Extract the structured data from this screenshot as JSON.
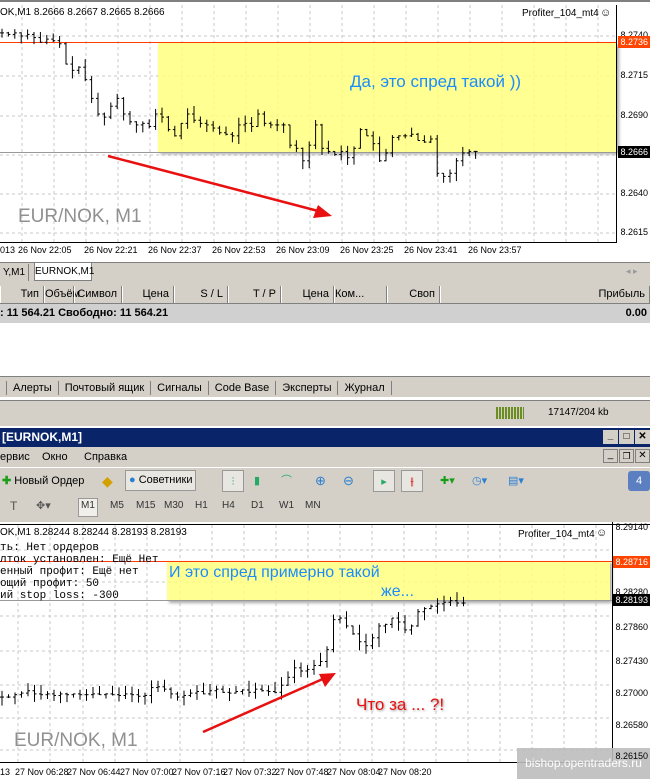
{
  "top_chart": {
    "info": "OK,M1  8.2666 8.2667 8.2665 8.2666",
    "expert": "Profiter_104_mt4",
    "annotation": "Да, это спред такой ))",
    "watermark": "EUR/NOK, M1",
    "ask_price": "8.2736",
    "bid_price": "8.2666",
    "ticks": [
      "8.2740",
      "8.2715",
      "8.2690",
      "8.2640",
      "8.2615"
    ],
    "times": [
      "013",
      "26 Nov 22:05",
      "26 Nov 22:21",
      "26 Nov 22:37",
      "26 Nov 22:53",
      "26 Nov 23:09",
      "26 Nov 23:25",
      "26 Nov 23:41",
      "26 Nov 23:57"
    ]
  },
  "chart_tabs": [
    "Y,M1",
    "EURNOK,M1"
  ],
  "terminal": {
    "columns": [
      "Тип",
      "Объём",
      "Символ",
      "Цена",
      "S / L",
      "T / P",
      "Цена",
      "Ком...",
      "Своп",
      "Прибыль"
    ],
    "balance": ": 11 564.21  Свободно: 11 564.21",
    "profit": "0.00",
    "tabs": [
      "Алерты",
      "Почтовый ящик",
      "Сигналы",
      "Code Base",
      "Эксперты",
      "Журнал"
    ]
  },
  "status": {
    "traffic": "17147/204 kb"
  },
  "window": {
    "title": "[EURNOK,M1]"
  },
  "menu": [
    "ервис",
    "Окно",
    "Справка"
  ],
  "toolbar": {
    "new_order": "Новый Ордер",
    "experts": "Советники",
    "badge": "4"
  },
  "timeframes": [
    "M1",
    "M5",
    "M15",
    "M30",
    "H1",
    "H4",
    "D1",
    "W1",
    "MN"
  ],
  "bottom_chart": {
    "info": "OK,M1  8.28244 8.28244 8.28193 8.28193",
    "expert": "Profiter_104_mt4",
    "comments": [
      "ть: Нет ордеров",
      "лток установлен: Ещё Нет",
      "енный профит: Ещё нет",
      "ощий профит: 50",
      "ий stop loss: -300"
    ],
    "annotation1": "И это спред примерно такой",
    "annotation2": "же...",
    "annotation3": "Что за ... ?!",
    "watermark": "EUR/NOK, M1",
    "ask_price": "8.28716",
    "bid_price": "8.28193",
    "ticks": [
      "8.29140",
      "8.28280",
      "8.27860",
      "8.27430",
      "8.27000",
      "8.26580",
      "8.26150"
    ],
    "times": [
      "13",
      "27 Nov 06:28",
      "27 Nov 06:44",
      "27 Nov 07:00",
      "27 Nov 07:16",
      "27 Nov 07:32",
      "27 Nov 07:48",
      "27 Nov 08:04",
      "27 Nov 08:20"
    ],
    "site": "bishop.opentraders.ru"
  },
  "chart_data": [
    {
      "type": "line",
      "title": "EUR/NOK, M1",
      "ylim": [
        8.261,
        8.2745
      ],
      "closes": [
        8.2742,
        8.2741,
        8.2742,
        8.274,
        8.2741,
        8.2739,
        8.2736,
        8.2738,
        8.2737,
        8.2735,
        8.2722,
        8.2718,
        8.272,
        8.2712,
        8.27,
        8.269,
        8.2688,
        8.2695,
        8.27,
        8.269,
        8.2685,
        8.2683,
        8.2684,
        8.2682,
        8.269,
        8.2688,
        8.268,
        8.2676,
        8.2684,
        8.269,
        8.2686,
        8.2684,
        8.2683,
        8.2681,
        8.2678,
        8.2677,
        8.2676,
        8.2683,
        8.2684,
        8.2682,
        8.269,
        8.2684,
        8.2683,
        8.2683,
        8.2683,
        8.267,
        8.2668,
        8.266,
        8.267,
        8.2683,
        8.2668,
        8.2666,
        8.2664,
        8.2666,
        8.2662,
        8.2668,
        8.268,
        8.2676,
        8.2671,
        8.266,
        8.2665,
        8.2675,
        8.2676,
        8.2676,
        8.2677,
        8.2673,
        8.2672,
        8.2674,
        8.2652,
        8.265,
        8.2652,
        8.266,
        8.2665,
        8.2666,
        8.2666
      ]
    },
    {
      "type": "line",
      "title": "EUR/NOK, M1",
      "ylim": [
        8.2615,
        8.2914
      ],
      "closes": [
        8.27,
        8.27,
        8.2703,
        8.2705,
        8.2708,
        8.2704,
        8.2703,
        8.2704,
        8.2702,
        8.2704,
        8.2703,
        8.2704,
        8.2703,
        8.2703,
        8.2704,
        8.2703,
        8.2704,
        8.2703,
        8.2702,
        8.2704,
        8.2703,
        8.2701,
        8.2702,
        8.2712,
        8.2713,
        8.271,
        8.2704,
        8.27,
        8.2702,
        8.2705,
        8.2707,
        8.2704,
        8.2708,
        8.271,
        8.2706,
        8.2705,
        8.2707,
        8.2709,
        8.2706,
        8.271,
        8.2708,
        8.2707,
        8.2706,
        8.2715,
        8.2725,
        8.2737,
        8.2733,
        8.2735,
        8.274,
        8.2745,
        8.276,
        8.2798,
        8.28,
        8.279,
        8.278,
        8.277,
        8.2765,
        8.2775,
        8.279,
        8.2792,
        8.28,
        8.2795,
        8.2785,
        8.279,
        8.2808,
        8.2812,
        8.2815,
        8.2818,
        8.282,
        8.2822,
        8.2819,
        8.2819
      ]
    }
  ]
}
